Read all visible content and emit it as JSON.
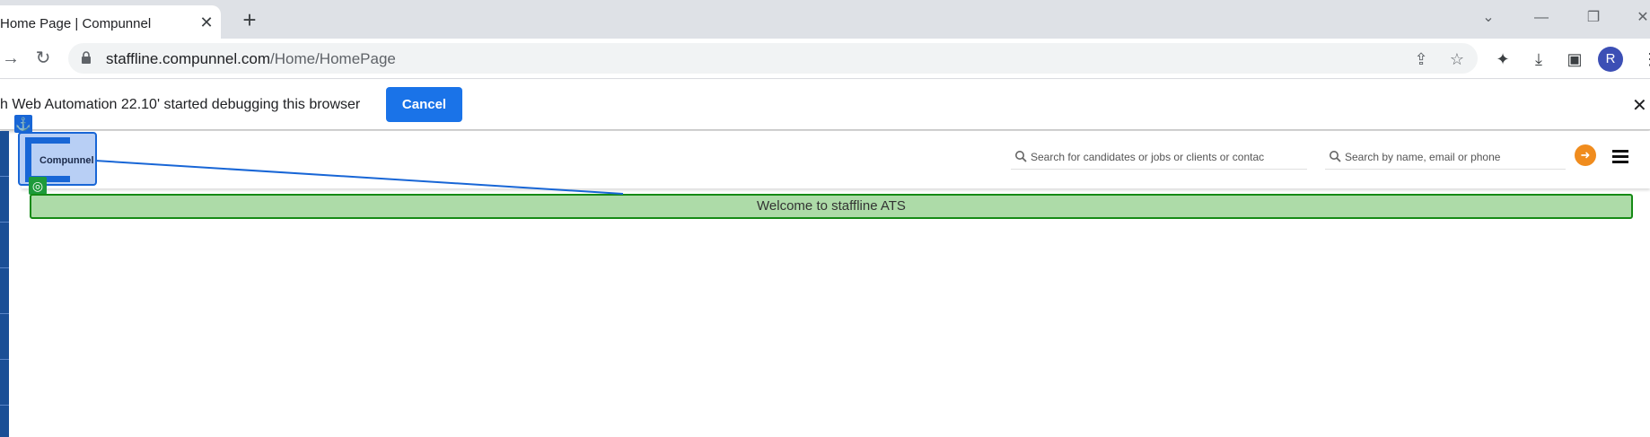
{
  "browser": {
    "tab_title": "Home Page | Compunnel",
    "tab_close_icon": "close-icon",
    "new_tab_icon": "plus-icon",
    "url_host": "staffline.compunnel.com",
    "url_path": "/Home/HomePage",
    "profile_initial": "R"
  },
  "infobar": {
    "message": "h Web Automation 22.10' started debugging this browser",
    "cancel_label": "Cancel"
  },
  "app": {
    "logo_text": "Compunnel",
    "search_main_placeholder": "Search for candidates or jobs or clients or contacts",
    "search_contact_placeholder": "Search by name, email or phone",
    "welcome_text": "Welcome to staffline ATS",
    "accent": "#1866d6",
    "signout_color": "#f08c1e",
    "highlight_green": "#158a15"
  }
}
